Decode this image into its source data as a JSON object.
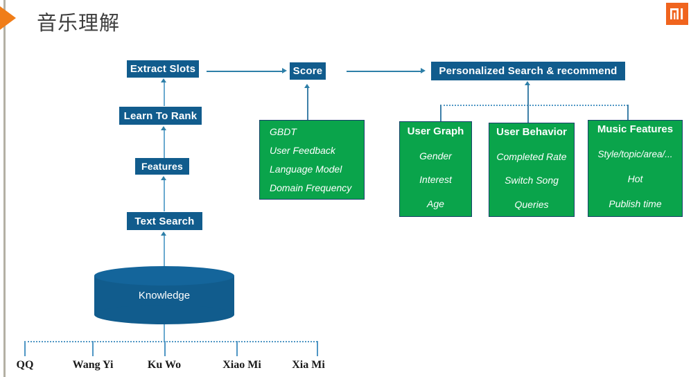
{
  "slide": {
    "title": "音乐理解",
    "brand_logo": "mi-logo",
    "accent_orange": "#f0641e",
    "accent_blue": "#115c8d",
    "accent_green": "#0aa44b",
    "connector_blue": "#2e7fa8"
  },
  "pipeline": {
    "extract_slots": "Extract Slots",
    "learn_to_rank": "Learn To Rank",
    "features": "Features",
    "text_search": "Text Search",
    "knowledge": "Knowledge",
    "score": "Score",
    "personalized": "Personalized Search & recommend"
  },
  "score_features": {
    "items": [
      "GBDT",
      "User Feedback",
      "Language Model",
      "Domain Frequency"
    ]
  },
  "personalization": {
    "boxes": [
      {
        "header": "User Graph",
        "items": [
          "Gender",
          "Interest",
          "Age"
        ]
      },
      {
        "header": "User Behavior",
        "items": [
          "Completed Rate",
          "Switch Song",
          "Queries"
        ]
      },
      {
        "header": "Music Features",
        "items": [
          "Style/topic/area/...",
          "Hot",
          "Publish time"
        ]
      }
    ]
  },
  "sources": {
    "labels": [
      "QQ",
      "Wang Yi",
      "Ku Wo",
      "Xiao Mi",
      "Xia Mi"
    ]
  }
}
